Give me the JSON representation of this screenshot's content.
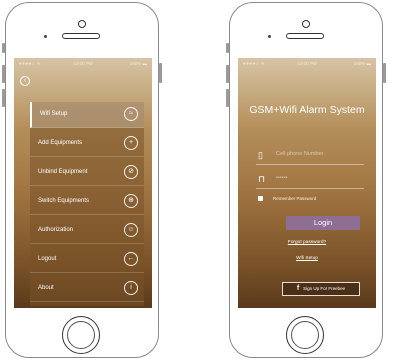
{
  "status_bar": {
    "carrier": "●●●●○ ✈",
    "time": "10:00 PM",
    "battery": "100% ▬"
  },
  "left_screen": {
    "back_icon": "‹",
    "menu": [
      {
        "label": "Wifi Setup",
        "icon": "wifi-icon",
        "glyph": "≈",
        "active": true
      },
      {
        "label": "Add Equipments",
        "icon": "plus-icon",
        "glyph": "+",
        "active": false
      },
      {
        "label": "Unbind Equipment",
        "icon": "unlink-icon",
        "glyph": "⊘",
        "active": false
      },
      {
        "label": "Switch Equipments",
        "icon": "switch-icon",
        "glyph": "⊕",
        "active": false
      },
      {
        "label": "Authorization",
        "icon": "user-icon",
        "glyph": "☺",
        "active": false
      },
      {
        "label": "Logout",
        "icon": "logout-icon",
        "glyph": "←",
        "active": false
      },
      {
        "label": "About",
        "icon": "info-icon",
        "glyph": "i",
        "active": false
      }
    ]
  },
  "right_screen": {
    "title": "GSM+Wifi Alarm System",
    "phone_placeholder": "Cell phone Number",
    "password_placeholder": "••••••",
    "remember": "Remember Password",
    "login": "Login",
    "forgot": "Forgot password?",
    "wifi_setup": "Wifi Setup",
    "facebook": "Sign Up For Freebee"
  }
}
